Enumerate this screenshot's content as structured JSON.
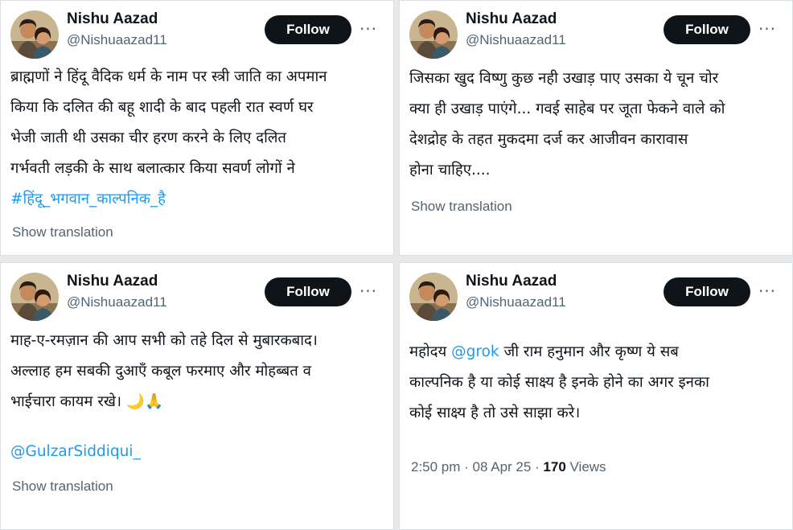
{
  "colors": {
    "link": "#1d9bf0",
    "button_bg": "#0f1419",
    "muted": "#536471"
  },
  "tweets": [
    {
      "name": "Nishu Aazad",
      "handle": "@Nishuaazad11",
      "follow_label": "Follow",
      "more_icon": "ellipsis-icon",
      "lines": [
        "ब्राह्मणों ने हिंदू वैदिक धर्म के नाम पर स्त्री जाति का अपमान",
        "किया कि दलित की बहू शादी के बाद पहली रात स्वर्ण घर",
        "भेजी जाती थी उसका चीर हरण करने के लिए दलित",
        "गर्भवती लड़की के साथ बलात्कार किया सवर्ण लोगों ने"
      ],
      "hashtag": "#हिंदू_भगवान_काल्पनिक_है",
      "show_translation": "Show translation"
    },
    {
      "name": "Nishu Aazad",
      "handle": "@Nishuaazad11",
      "follow_label": "Follow",
      "more_icon": "ellipsis-icon",
      "lines": [
        "जिसका खुद विष्णु कुछ नही उखाड़ पाए उसका ये चून चोर",
        "क्या ही उखाड़ पाएंगे... गवई साहेब पर जूता फेकने वाले को",
        "देशद्रोह के तहत मुकदमा दर्ज कर आजीवन कारावास",
        "होना चाहिए...."
      ],
      "show_translation": "Show translation"
    },
    {
      "name": "Nishu Aazad",
      "handle": "@Nishuaazad11",
      "follow_label": "Follow",
      "more_icon": "ellipsis-icon",
      "lines": [
        "माह-ए-रमज़ान की आप सभी को तहे दिल से मुबारकबाद।",
        "अल्लाह हम सबकी दुआएँ कबूल फरमाए और मोहब्बत व",
        "भाईचारा कायम रखे। 🌙🙏"
      ],
      "mention": "@GulzarSiddiqui_",
      "show_translation": "Show translation"
    },
    {
      "name": "Nishu Aazad",
      "handle": "@Nishuaazad11",
      "follow_label": "Follow",
      "more_icon": "ellipsis-icon",
      "line1_before": "महोदय ",
      "line1_mention": "@grok",
      "line1_after": " जी राम हनुमान और कृष्ण ये सब",
      "lines": [
        "काल्पनिक है या कोई साक्ष्य है इनके होने का अगर इनका",
        "कोई साक्ष्य है तो उसे साझा करे।"
      ],
      "timestamp": "2:50 pm · 08 Apr 25 · ",
      "views_count": "170",
      "views_label": " Views"
    }
  ]
}
